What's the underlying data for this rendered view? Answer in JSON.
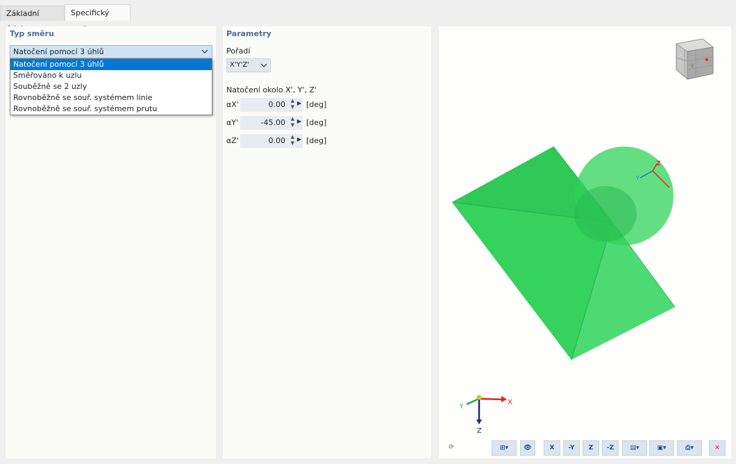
{
  "tabs": [
    {
      "label": "Základní údaje"
    },
    {
      "label": "Specifický směr"
    }
  ],
  "typ_smeru": {
    "title": "Typ směru",
    "selected": "Natočení pomocí 3 úhlů",
    "options": [
      "Natočení pomocí 3 úhlů",
      "Směřováno k uzlu",
      "Souběžně se 2 uzly",
      "Rovnoběžně se souř. systémem linie",
      "Rovnoběžně se souř. systémem prutu"
    ]
  },
  "parametry": {
    "title": "Parametry",
    "poradi_label": "Pořadí",
    "poradi_value": "X'Y'Z'",
    "natoceni_label": "Natočení okolo X', Y', Z'",
    "angles": [
      {
        "symbol": "αX'",
        "value": "0.00",
        "unit": "[deg]"
      },
      {
        "symbol": "αY'",
        "value": "-45.00",
        "unit": "[deg]"
      },
      {
        "symbol": "αZ'",
        "value": "0.00",
        "unit": "[deg]"
      }
    ]
  },
  "viewport": {
    "axis_labels": {
      "x": "X",
      "y": "Y",
      "z": "Z"
    },
    "local_axis_labels": {
      "z": "Z",
      "y": "Y"
    },
    "colors": {
      "shape": "#2fd35a",
      "x_axis": "#e0281e",
      "y_axis": "#2ca54a",
      "z_axis": "#1a2a6b"
    }
  },
  "toolbar": {
    "view_x": "X",
    "view_neg_y": "-Y",
    "view_z": "Z",
    "view_neg_z": "-Z"
  }
}
